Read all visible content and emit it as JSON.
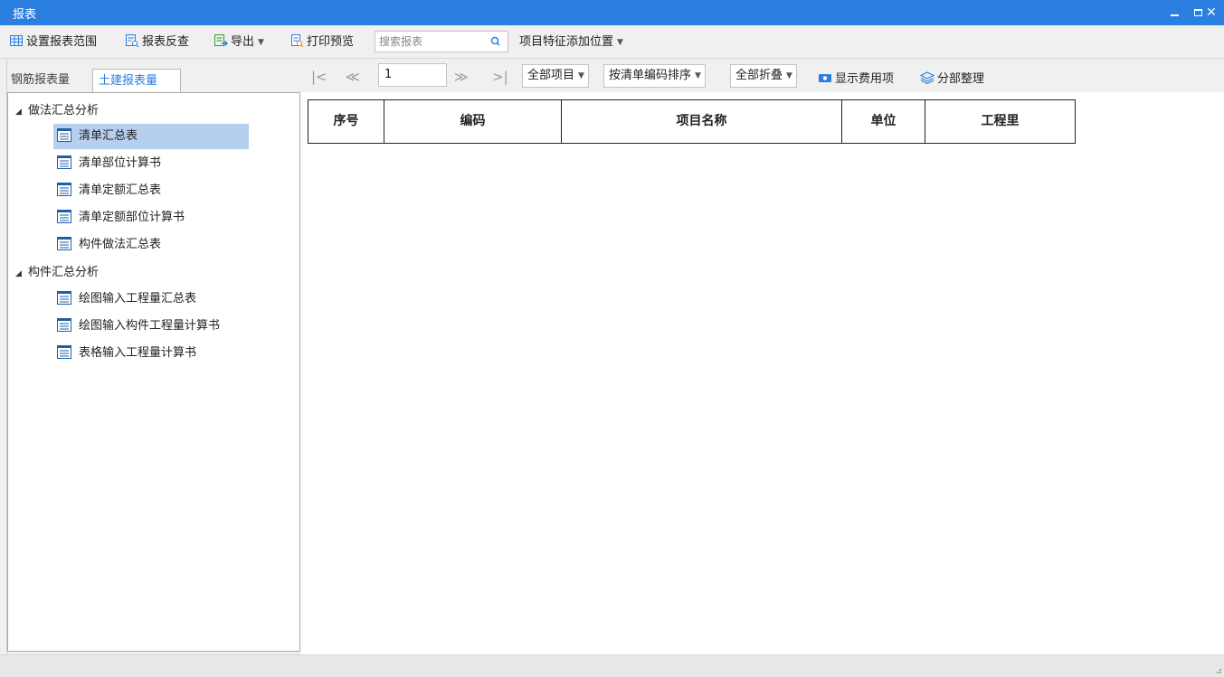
{
  "window": {
    "title": "报表"
  },
  "toolbar": {
    "set_range": "设置报表范围",
    "report_reverse": "报表反查",
    "export": "导出",
    "print_preview": "打印预览",
    "search_placeholder": "搜索报表",
    "feature_position": "项目特征添加位置"
  },
  "tabs": {
    "rebar": "钢筋报表量",
    "civil": "土建报表量"
  },
  "tree": {
    "group1": {
      "label": "做法汇总分析",
      "items": [
        "清单汇总表",
        "清单部位计算书",
        "清单定额汇总表",
        "清单定额部位计算书",
        "构件做法汇总表"
      ]
    },
    "group2": {
      "label": "构件汇总分析",
      "items": [
        "绘图输入工程量汇总表",
        "绘图输入构件工程量计算书",
        "表格输入工程量计算书"
      ]
    },
    "selected": "清单汇总表"
  },
  "navbar": {
    "page": "1",
    "filter_items": "全部项目",
    "sort": "按清单编码排序",
    "collapse": "全部折叠",
    "show_fee": "显示费用项",
    "section_arrange": "分部整理"
  },
  "table": {
    "headers": [
      "序号",
      "编码",
      "项目名称",
      "单位",
      "工程里"
    ]
  },
  "colors": {
    "accent": "#2b7fe0",
    "selected_row": "#b6cfee"
  }
}
